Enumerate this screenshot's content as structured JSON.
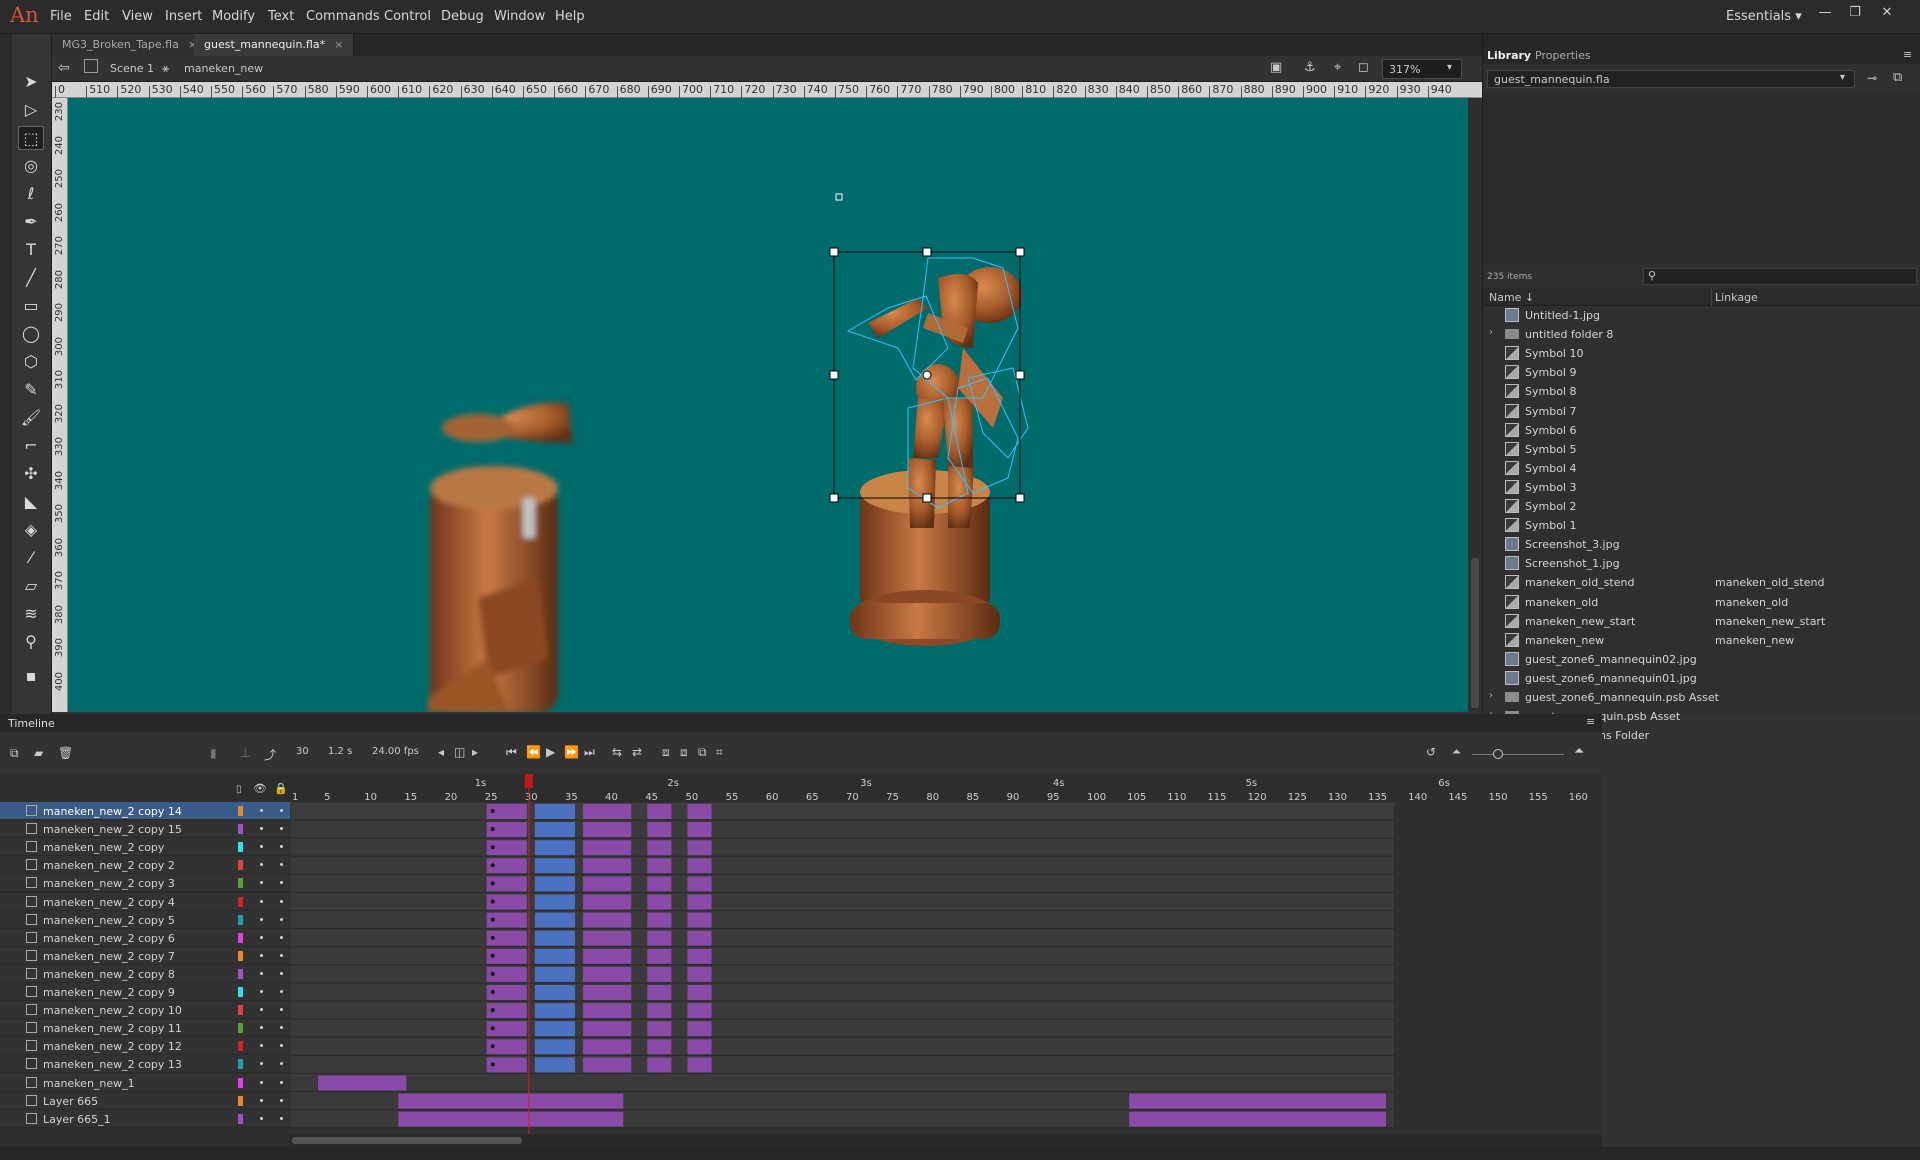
{
  "app": {
    "logo": "An"
  },
  "menu": [
    "File",
    "Edit",
    "View",
    "Insert",
    "Modify",
    "Text",
    "Commands",
    "Control",
    "Debug",
    "Window",
    "Help"
  ],
  "workspace": "Essentials",
  "window_controls": {
    "minimize": "—",
    "restore": "❐",
    "close": "✕"
  },
  "doc_tabs": [
    {
      "label": "MG3_Broken_Tape.fla",
      "close": "×"
    },
    {
      "label": "guest_mannequin.fla*",
      "close": "×"
    }
  ],
  "editbar": {
    "back": "⇦",
    "scene": "Scene 1",
    "symbol": "maneken_new",
    "zoom": "317%"
  },
  "ruler_top": [
    "0",
    "510",
    "520",
    "530",
    "540",
    "550",
    "560",
    "570",
    "580",
    "590",
    "600",
    "610",
    "620",
    "630",
    "640",
    "650",
    "660",
    "670",
    "680",
    "690",
    "700",
    "710",
    "720",
    "730",
    "740",
    "750",
    "760",
    "770",
    "780",
    "790",
    "800",
    "810",
    "820",
    "830",
    "840",
    "850",
    "860",
    "870",
    "880",
    "890",
    "900",
    "910",
    "920",
    "930",
    "940"
  ],
  "ruler_left": [
    "230",
    "240",
    "250",
    "260",
    "270",
    "280",
    "290",
    "300",
    "310",
    "320",
    "330",
    "340",
    "350",
    "360",
    "370",
    "380",
    "390",
    "400"
  ],
  "library": {
    "tabs": [
      "Library",
      "Properties"
    ],
    "document": "guest_mannequin.fla",
    "count": "235 items",
    "col_name": "Name ↓",
    "col_linkage": "Linkage",
    "items": [
      {
        "name": "Untitled-1.jpg",
        "type": "bitmap",
        "linkage": ""
      },
      {
        "name": "untitled folder 8",
        "type": "folder",
        "linkage": ""
      },
      {
        "name": "Symbol 10",
        "type": "symbol",
        "linkage": ""
      },
      {
        "name": "Symbol 9",
        "type": "symbol",
        "linkage": ""
      },
      {
        "name": "Symbol 8",
        "type": "symbol",
        "linkage": ""
      },
      {
        "name": "Symbol 7",
        "type": "symbol",
        "linkage": ""
      },
      {
        "name": "Symbol 6",
        "type": "symbol",
        "linkage": ""
      },
      {
        "name": "Symbol 5",
        "type": "symbol",
        "linkage": ""
      },
      {
        "name": "Symbol 4",
        "type": "symbol",
        "linkage": ""
      },
      {
        "name": "Symbol 3",
        "type": "symbol",
        "linkage": ""
      },
      {
        "name": "Symbol 2",
        "type": "symbol",
        "linkage": ""
      },
      {
        "name": "Symbol 1",
        "type": "symbol",
        "linkage": ""
      },
      {
        "name": "Screenshot_3.jpg",
        "type": "bitmap",
        "linkage": ""
      },
      {
        "name": "Screenshot_1.jpg",
        "type": "bitmap",
        "linkage": ""
      },
      {
        "name": "maneken_old_stend",
        "type": "symbol",
        "linkage": "maneken_old_stend"
      },
      {
        "name": "maneken_old",
        "type": "symbol",
        "linkage": "maneken_old"
      },
      {
        "name": "maneken_new_start",
        "type": "symbol",
        "linkage": "maneken_new_start"
      },
      {
        "name": "maneken_new",
        "type": "symbol",
        "linkage": "maneken_new"
      },
      {
        "name": "guest_zone6_mannequin02.jpg",
        "type": "bitmap",
        "linkage": ""
      },
      {
        "name": "guest_zone6_mannequin01.jpg",
        "type": "bitmap",
        "linkage": ""
      },
      {
        "name": "guest_zone6_mannequin.psb Asset",
        "type": "folder",
        "linkage": ""
      },
      {
        "name": "guest_mannequin.psb Asset",
        "type": "folder",
        "linkage": ""
      },
      {
        "name": "Duplicate Items Folder",
        "type": "folder",
        "linkage": ""
      }
    ]
  },
  "timeline": {
    "title": "Timeline",
    "current_frame": "30",
    "time": "1.2 s",
    "fps": "24.00 fps",
    "seconds": [
      "1s",
      "2s",
      "3s",
      "4s",
      "5s",
      "6s"
    ],
    "frame_numbers": [
      "1",
      "5",
      "10",
      "15",
      "20",
      "25",
      "30",
      "35",
      "40",
      "45",
      "50",
      "55",
      "60",
      "65",
      "70",
      "75",
      "80",
      "85",
      "90",
      "95",
      "100",
      "105",
      "110",
      "115",
      "120",
      "125",
      "130",
      "135",
      "140",
      "145",
      "150",
      "155",
      "160"
    ],
    "layers": [
      {
        "name": "maneken_new_2 copy 14",
        "color": "#e88a2c",
        "selected": true
      },
      {
        "name": "maneken_new_2 copy 15",
        "color": "#a050c8",
        "selected": false
      },
      {
        "name": "maneken_new_2 copy",
        "color": "#2ee0f0",
        "selected": false
      },
      {
        "name": "maneken_new_2 copy 2",
        "color": "#e04040",
        "selected": false
      },
      {
        "name": "maneken_new_2 copy 3",
        "color": "#58a030",
        "selected": false
      },
      {
        "name": "maneken_new_2 copy 4",
        "color": "#d02020",
        "selected": false
      },
      {
        "name": "maneken_new_2 copy 5",
        "color": "#20a0a0",
        "selected": false
      },
      {
        "name": "maneken_new_2 copy 6",
        "color": "#e040e0",
        "selected": false
      },
      {
        "name": "maneken_new_2 copy 7",
        "color": "#e88a2c",
        "selected": false
      },
      {
        "name": "maneken_new_2 copy 8",
        "color": "#a050c8",
        "selected": false
      },
      {
        "name": "maneken_new_2 copy 9",
        "color": "#2ee0f0",
        "selected": false
      },
      {
        "name": "maneken_new_2 copy 10",
        "color": "#e04040",
        "selected": false
      },
      {
        "name": "maneken_new_2 copy 11",
        "color": "#58a030",
        "selected": false
      },
      {
        "name": "maneken_new_2 copy 12",
        "color": "#d02020",
        "selected": false
      },
      {
        "name": "maneken_new_2 copy 13",
        "color": "#20a0a0",
        "selected": false
      },
      {
        "name": "maneken_new_1",
        "color": "#e040e0",
        "selected": false
      },
      {
        "name": "Layer 665",
        "color": "#e88a2c",
        "selected": false
      },
      {
        "name": "Layer 665_1",
        "color": "#a050c8",
        "selected": false
      }
    ]
  }
}
